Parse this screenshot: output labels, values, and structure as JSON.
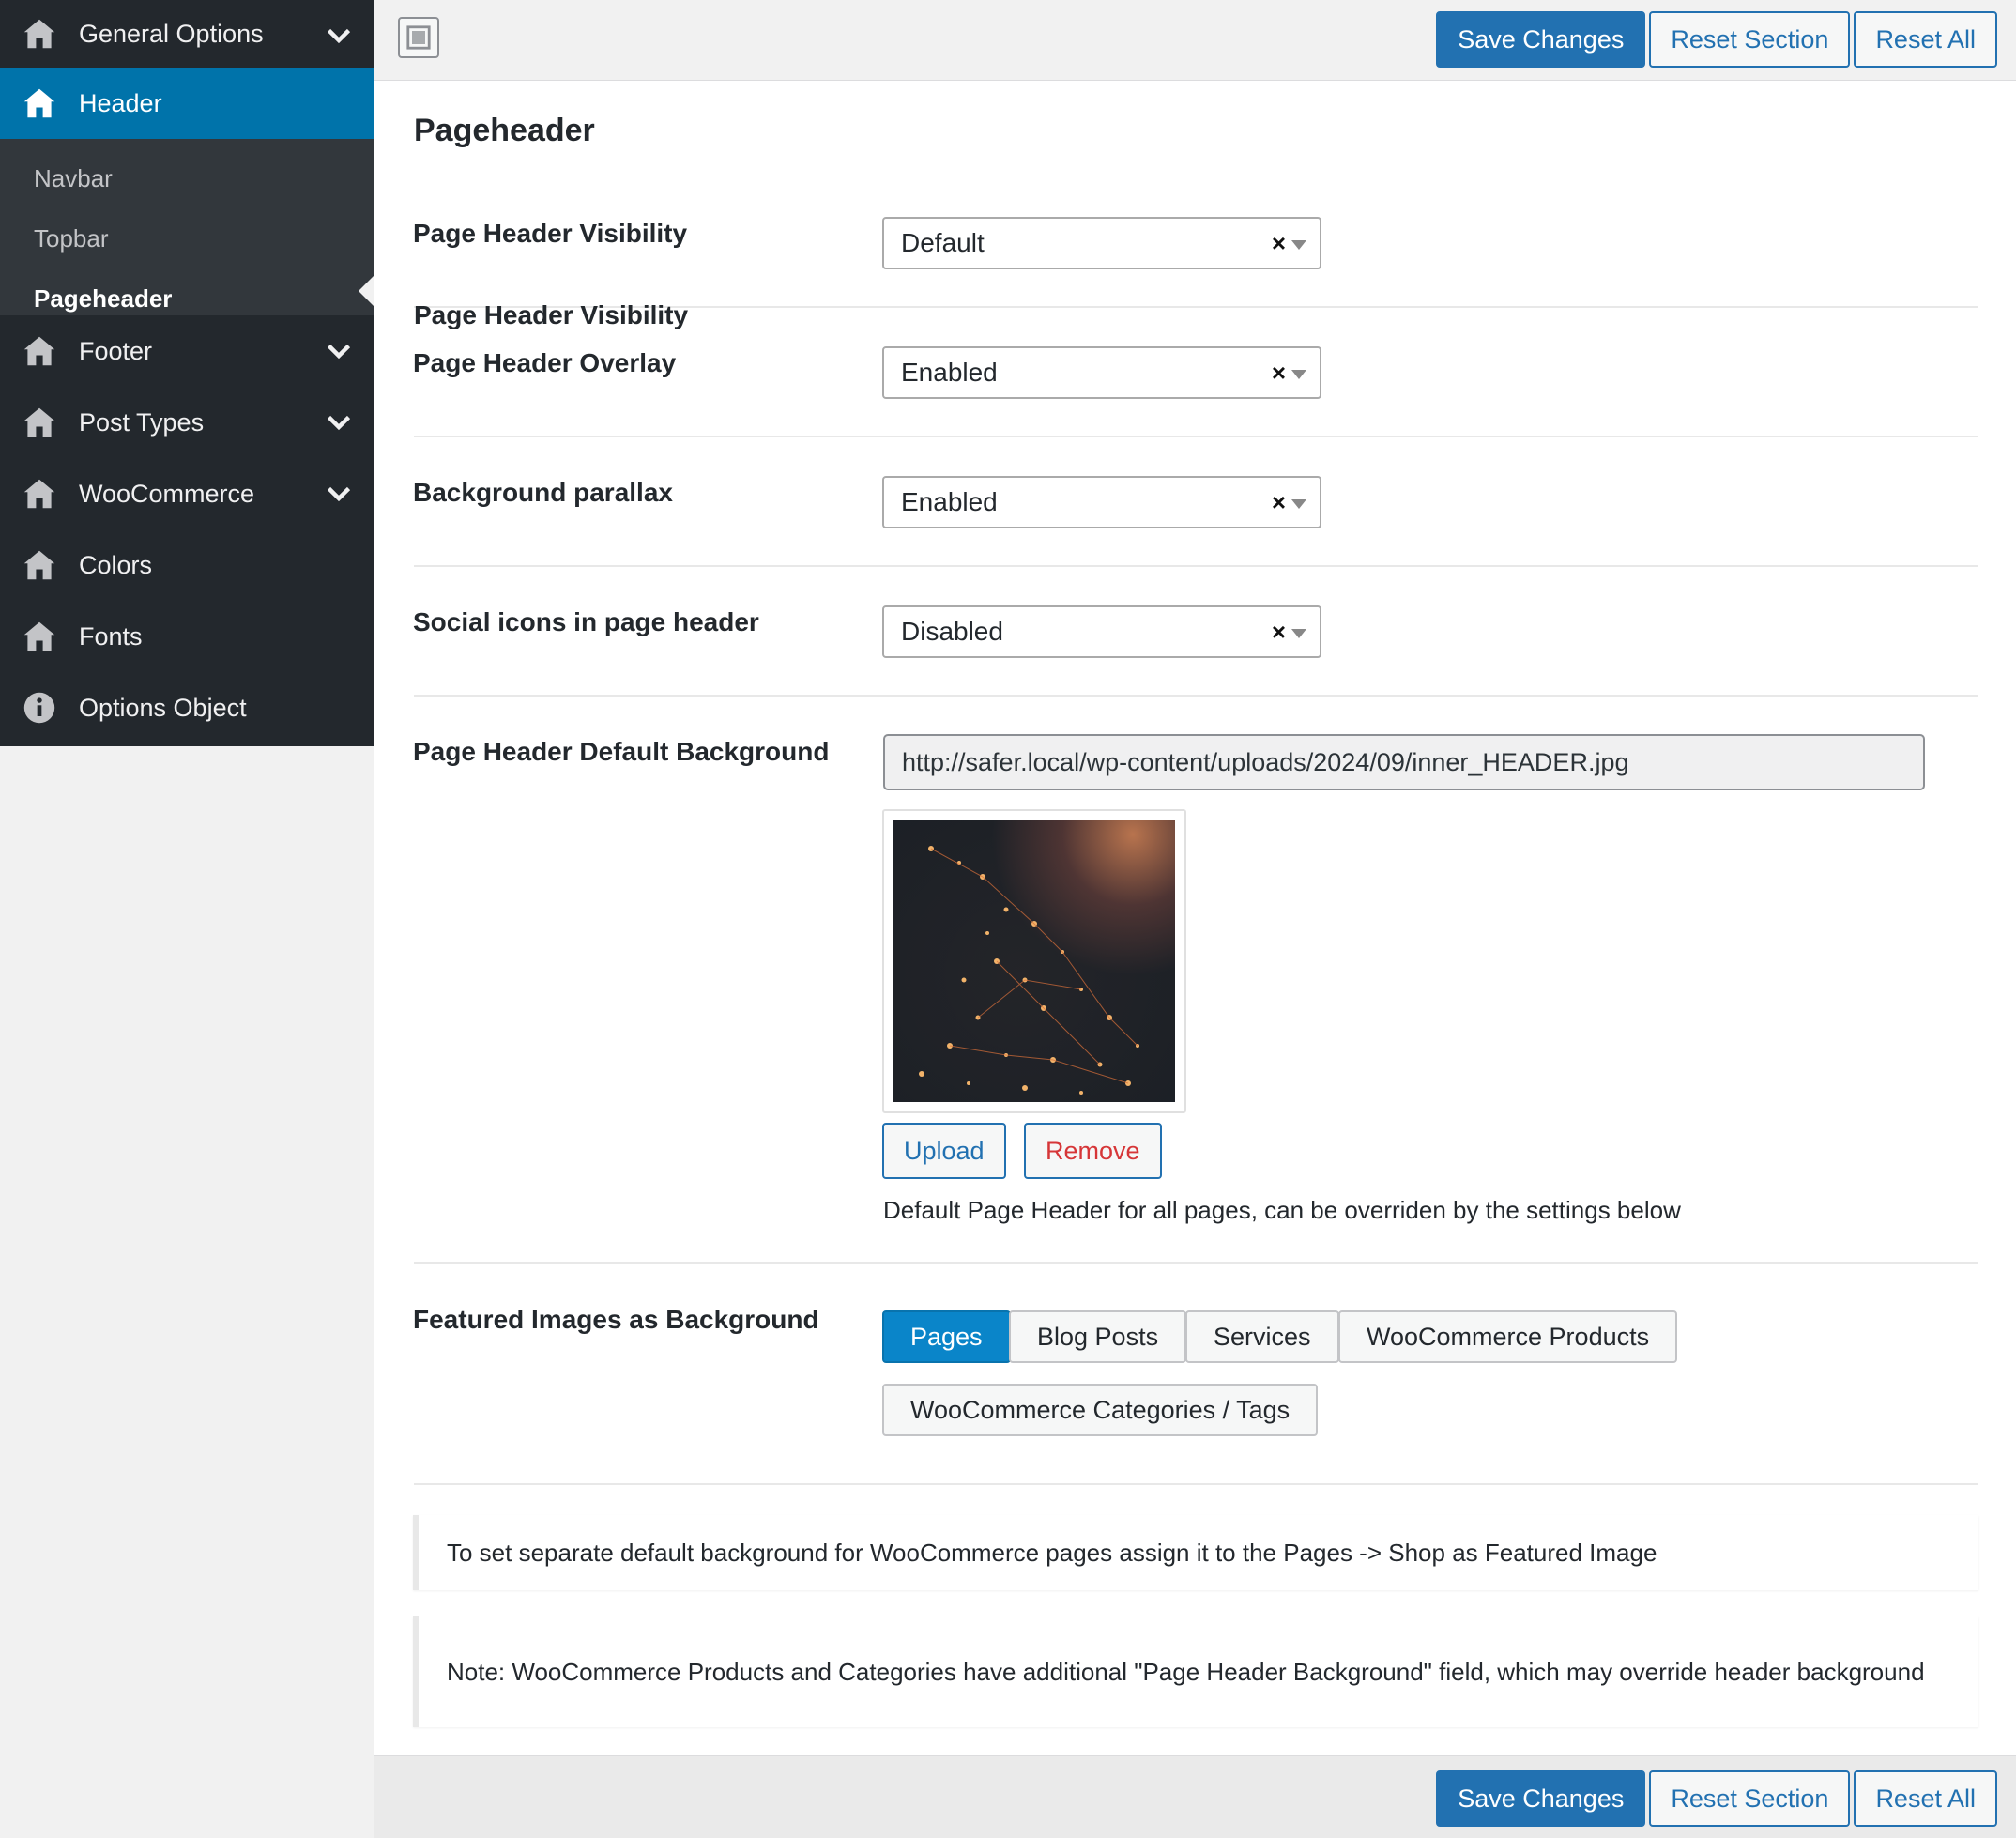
{
  "sidebar": {
    "items": [
      {
        "label": "General Options",
        "icon": "home-icon",
        "chevron": true
      },
      {
        "label": "Header",
        "icon": "home-icon",
        "active": true
      },
      {
        "label": "Footer",
        "icon": "home-icon",
        "chevron": true
      },
      {
        "label": "Post Types",
        "icon": "home-icon",
        "chevron": true
      },
      {
        "label": "WooCommerce",
        "icon": "home-icon",
        "chevron": true
      },
      {
        "label": "Colors",
        "icon": "home-icon"
      },
      {
        "label": "Fonts",
        "icon": "home-icon"
      },
      {
        "label": "Options Object",
        "icon": "info-icon"
      }
    ],
    "submenu": [
      "Navbar",
      "Topbar",
      "Pageheader"
    ],
    "current_submenu": "Pageheader"
  },
  "toolbar": {
    "save_label": "Save Changes",
    "reset_section_label": "Reset Section",
    "reset_all_label": "Reset All"
  },
  "section": {
    "title": "Pageheader",
    "fields": [
      {
        "label": "Page Header Visibility",
        "value": "Default"
      },
      {
        "label": "Page Header Overlay",
        "value": "Enabled"
      },
      {
        "label": "Background parallax",
        "value": "Enabled"
      },
      {
        "label": "Social icons in page header",
        "value": "Disabled"
      }
    ],
    "background": {
      "label": "Page Header Default Background",
      "url": "http://safer.local/wp-content/uploads/2024/09/inner_HEADER.jpg",
      "upload_label": "Upload",
      "remove_label": "Remove",
      "help": "Default Page Header for all pages, can be overriden by the settings below"
    },
    "featured": {
      "label": "Featured Images as Background",
      "options": [
        "Pages",
        "Blog Posts",
        "Services",
        "WooCommerce Products",
        "WooCommerce Categories / Tags"
      ],
      "selected": "Pages"
    },
    "notices": [
      "To set separate default background for WooCommerce pages assign it to the Pages -> Shop as Featured Image",
      "Note: WooCommerce Products and Categories have additional \"Page Header Background\" field, which may override header background"
    ]
  },
  "colors": {
    "sidebar_bg": "#23282d",
    "active_bg": "#0073aa",
    "primary": "#2271b1",
    "remove": "#d63638"
  }
}
